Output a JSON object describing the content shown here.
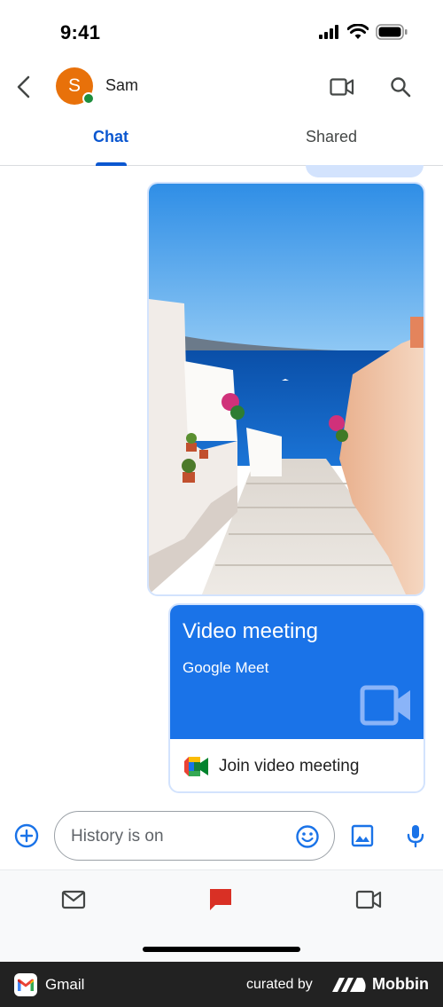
{
  "status_bar": {
    "time": "9:41"
  },
  "header": {
    "avatar_initial": "S",
    "contact_name": "Sam"
  },
  "tabs": [
    {
      "label": "Chat",
      "active": true
    },
    {
      "label": "Shared",
      "active": false
    }
  ],
  "messages": {
    "image_description_icon": "photo-santorini",
    "meeting_card": {
      "title": "Video meeting",
      "subtitle": "Google Meet",
      "join_label": "Join video meeting"
    }
  },
  "composer": {
    "placeholder": "History is on"
  },
  "bottom_nav": {
    "items": [
      {
        "icon": "mail-icon",
        "active": false
      },
      {
        "icon": "chat-icon",
        "active": true
      },
      {
        "icon": "meet-icon",
        "active": false
      }
    ]
  },
  "brand_bar": {
    "app_name": "Gmail",
    "curated_by": "curated by",
    "brand": "Mobbin"
  },
  "colors": {
    "accent": "#0b57d0",
    "meet_blue": "#1a73e8",
    "avatar": "#e8710a",
    "active_nav": "#d93025"
  }
}
